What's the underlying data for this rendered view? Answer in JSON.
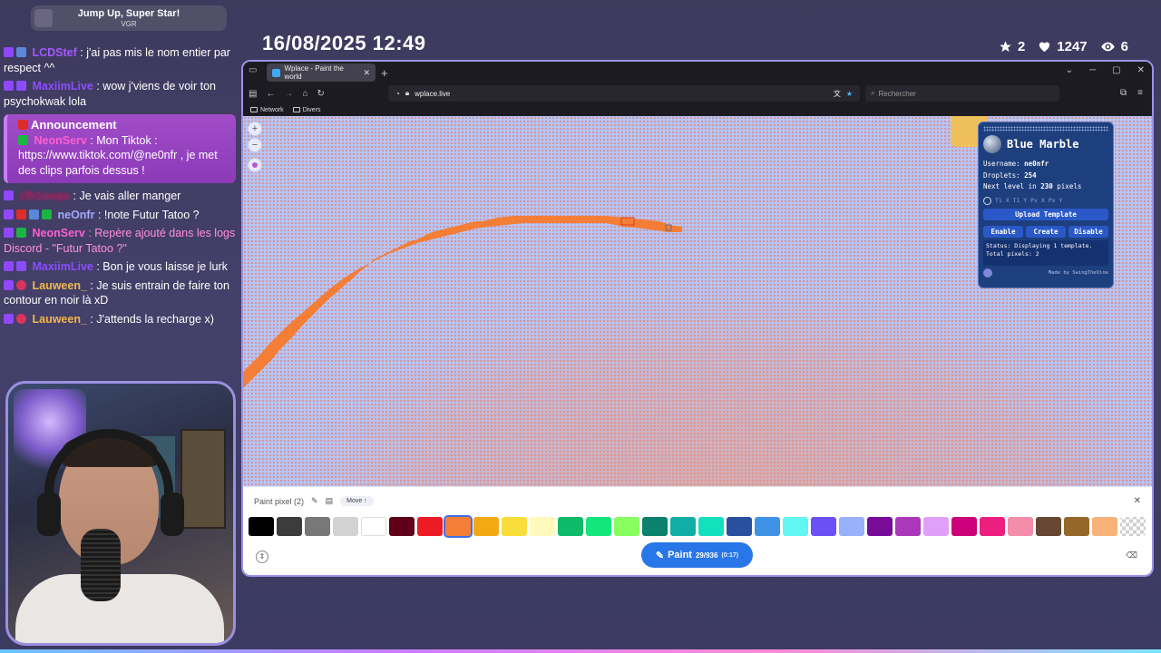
{
  "now_playing": {
    "title": "Jump Up, Super Star!",
    "artist": "VGR"
  },
  "chat": {
    "messages": [
      {
        "user": "LCDStef",
        "color": "#a259ff",
        "badge": "sub",
        "text": ": j'ai pas mis le nom entier par respect ^^"
      },
      {
        "user": "MaxiimLive",
        "color": "#8a4dff",
        "badge": "vip",
        "text": ": wow j'viens de voir ton psychokwak lola"
      },
      {
        "user": "neOnfr",
        "color": "#b04dff",
        "badge": "red",
        "text": ": Je vais aller manger"
      },
      {
        "user": "neOnfr",
        "color": "#a9a9ff",
        "badge": "mod",
        "text": ": !note Futur Tatoo ?"
      },
      {
        "user": "NeonServ",
        "color": "#ff5fd1",
        "badge": "mod",
        "text": ": Repère ajouté dans les logs Discord - \"Futur Tatoo ?\"",
        "text_color": "#ff8fe0"
      },
      {
        "user": "MaxiimLive",
        "color": "#8a4dff",
        "badge": "vip",
        "text": ": Bon je vous laisse je lurk"
      },
      {
        "user": "Lauween_",
        "color": "#f2b84b",
        "badge": "heart",
        "text": ": Je suis entrain de faire ton contour en noir là xD"
      },
      {
        "user": "Lauween_",
        "color": "#f2b84b",
        "badge": "heart",
        "text": ": J'attends la recharge x)"
      }
    ],
    "announcement": {
      "title": "Announcement",
      "user": "NeonServ",
      "text": ": Mon Tiktok : https://www.tiktok.com/@ne0nfr , je met des clips parfois dessus !"
    }
  },
  "overlay": {
    "datetime": "16/08/2025 12:49",
    "stats": {
      "stars": "2",
      "hearts": "1247",
      "viewers": "6"
    }
  },
  "browser": {
    "tab_title": "Wplace - Paint the world",
    "url": "wplace.live",
    "search_placeholder": "Rechercher",
    "bookmarks": [
      "Network",
      "Divers"
    ]
  },
  "blue_marble": {
    "title": "Blue Marble",
    "username_label": "Username:",
    "username": "ne0nfr",
    "droplets_label": "Droplets:",
    "droplets": "254",
    "next_level_prefix": "Next level in",
    "next_level_value": "230",
    "next_level_suffix": "pixels",
    "coord_fields": "T1 X   T1 Y   Px X   Px Y",
    "upload_label": "Upload Template",
    "enable_label": "Enable",
    "create_label": "Create",
    "disable_label": "Disable",
    "status_text": "Status: Displaying 1 template. Total pixels: 2",
    "footer": "Made by SwingTheVine"
  },
  "paint_bar": {
    "title": "Paint pixel",
    "count": "(2)",
    "move_label": "Move ↑",
    "paint_label": "Paint",
    "paint_progress": "29/936",
    "paint_sub": "(0:17)",
    "selected_color": "#f47e36",
    "palette": [
      "#000000",
      "#3c3c3c",
      "#787878",
      "#d2d2d2",
      "#ffffff",
      "#600018",
      "#ed1c24",
      "#f47e36",
      "#f2a913",
      "#f9dd3b",
      "#fffabc",
      "#0eb968",
      "#13e67b",
      "#87ff5e",
      "#0c816e",
      "#10aea6",
      "#13e1be",
      "#28509e",
      "#4093e4",
      "#60f7f2",
      "#6b50f6",
      "#99b1fb",
      "#780c99",
      "#aa38b9",
      "#e09ff9",
      "#cb007a",
      "#ec1f80",
      "#f38da9",
      "#684634",
      "#95682a",
      "#f8b277",
      "transparent"
    ]
  }
}
